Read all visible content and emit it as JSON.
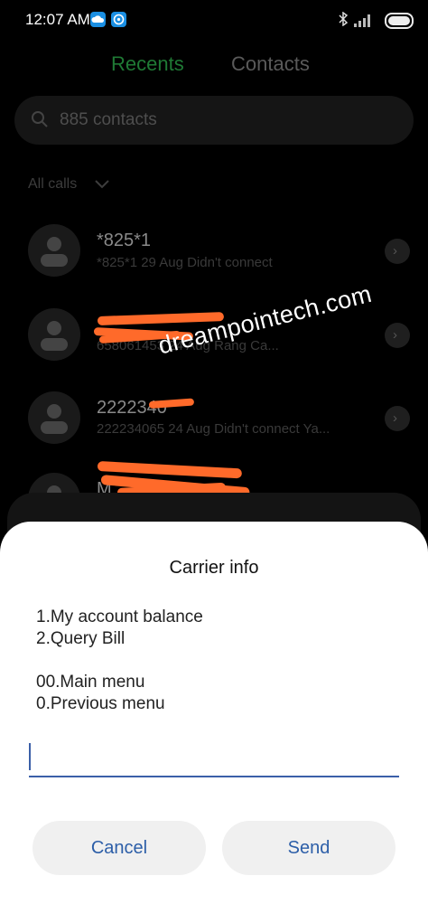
{
  "status_bar": {
    "time": "12:07 AM"
  },
  "tabs": [
    {
      "label": "Recents"
    },
    {
      "label": "Contacts"
    }
  ],
  "search": {
    "placeholder": "885 contacts"
  },
  "filter": {
    "label": "All calls"
  },
  "calls": [
    {
      "name": "*825*1",
      "detail": "*825*1  29 Aug Didn't connect"
    },
    {
      "name": "",
      "detail": "658061453  24 Aug Rang  Ca..."
    },
    {
      "name": "2222340",
      "detail": "222234065  24 Aug Didn't connect  Ya..."
    },
    {
      "name": "M",
      "detail": ""
    }
  ],
  "watermark": "dreampointech.com",
  "dialog": {
    "title": "Carrier info",
    "menu": [
      "1.My account balance",
      "2.Query Bill",
      "00.Main menu",
      "0.Previous menu"
    ],
    "input_value": "",
    "cancel_label": "Cancel",
    "send_label": "Send"
  },
  "colors": {
    "accent_green": "#1f7a35",
    "dialog_button_text": "#2c5ea8",
    "scribble": "#ff6a2a"
  }
}
